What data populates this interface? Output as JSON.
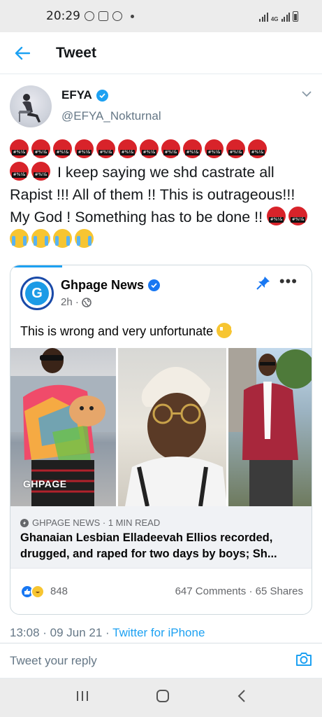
{
  "status_bar": {
    "time": "20:29",
    "network": "4G"
  },
  "header": {
    "title": "Tweet"
  },
  "tweet": {
    "author_name": "EFYA",
    "author_handle": "@EFYA_Nokturnal",
    "text_line1": "I keep saying we shd castrate all Rapist !!! All of them !! This is outrageous!!! My God ! Something has to be done !!",
    "timestamp": "13:08 · 09 Jun 21 · ",
    "source": "Twitter for iPhone"
  },
  "card": {
    "page_name": "Ghpage News",
    "post_time": "2h ·",
    "post_text": "This is wrong and very unfortunate",
    "watermark": "GHPAGE",
    "link_source": "GHPAGE NEWS · 1 MIN READ",
    "link_title": "Ghanaian Lesbian Elladeevah Ellios recorded, drugged, and raped for two days by boys; Sh...",
    "reaction_count": "848",
    "stats": "647 Comments · 65 Shares"
  },
  "reply": {
    "placeholder": "Tweet your reply"
  },
  "colors": {
    "twitter_blue": "#1da1f2",
    "facebook_blue": "#1877f2",
    "angry_red": "#d8232a"
  }
}
